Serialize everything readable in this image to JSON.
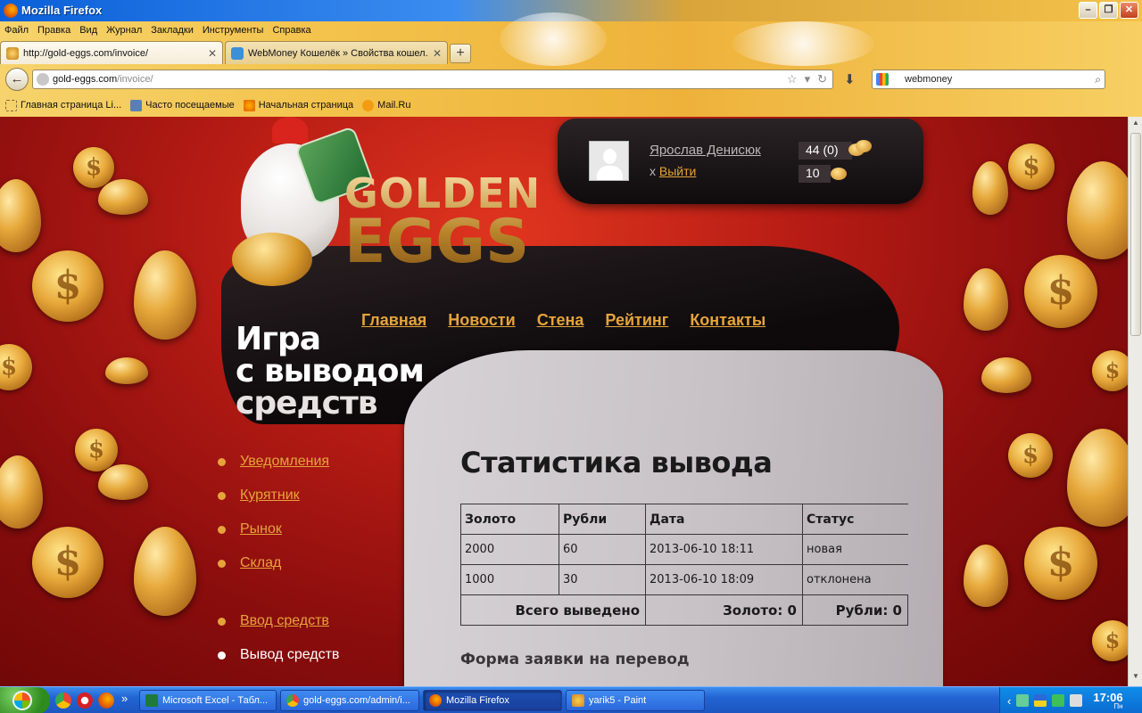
{
  "window": {
    "title": "Mozilla Firefox"
  },
  "menu": [
    "Файл",
    "Правка",
    "Вид",
    "Журнал",
    "Закладки",
    "Инструменты",
    "Справка"
  ],
  "tabs": [
    {
      "label": "http://gold-eggs.com/invoice/",
      "active": true
    },
    {
      "label": "WebMoney Кошелёк » Свойства кошел...",
      "active": false
    }
  ],
  "address": {
    "host": "gold-eggs.com",
    "path": "/invoice/"
  },
  "search": {
    "value": "webmoney"
  },
  "bookmarks": [
    "Главная страница Li...",
    "Часто посещаемые",
    "Начальная страница",
    "Mail.Ru"
  ],
  "user": {
    "name": "Ярослав Денисюк",
    "logout_prefix": "x",
    "logout": "Выйти",
    "gold": "44 (0)",
    "eggs": "10"
  },
  "logo": {
    "line1": "GOLDEN",
    "line2": "EGGS"
  },
  "nav": [
    "Главная",
    "Новости",
    "Стена",
    "Рейтинг",
    "Контакты"
  ],
  "tagline": [
    "Игра",
    "с выводом",
    "средств"
  ],
  "sidenav": [
    {
      "label": "Уведомления",
      "current": false
    },
    {
      "label": "Курятник",
      "current": false
    },
    {
      "label": "Рынок",
      "current": false
    },
    {
      "label": "Склад",
      "current": false
    },
    {
      "label": "Ввод средств",
      "current": false
    },
    {
      "label": "Вывод средств",
      "current": true
    }
  ],
  "content": {
    "title": "Статистика вывода",
    "table": {
      "headers": [
        "Золото",
        "Рубли",
        "Дата",
        "Статус"
      ],
      "rows": [
        [
          "2000",
          "60",
          "2013-06-10 18:11",
          "новая"
        ],
        [
          "1000",
          "30",
          "2013-06-10 18:09",
          "отклонена"
        ]
      ],
      "total": {
        "label": "Всего выведено",
        "gold": "Золото: 0",
        "rub": "Рубли: 0"
      }
    },
    "form_title": "Форма заявки на перевод"
  },
  "taskbar": {
    "buttons": [
      {
        "label": "Microsoft Excel - Табл...",
        "active": false
      },
      {
        "label": "gold-eggs.com/admin/i...",
        "active": false
      },
      {
        "label": "Mozilla Firefox",
        "active": true
      },
      {
        "label": "yarik5 - Paint",
        "active": false
      }
    ],
    "clock": "17:06",
    "weekday": "Пн"
  },
  "colors": {
    "accent": "#e5a43a",
    "page_red": "#b51b14",
    "dark_panel": "#0e0a0c"
  }
}
